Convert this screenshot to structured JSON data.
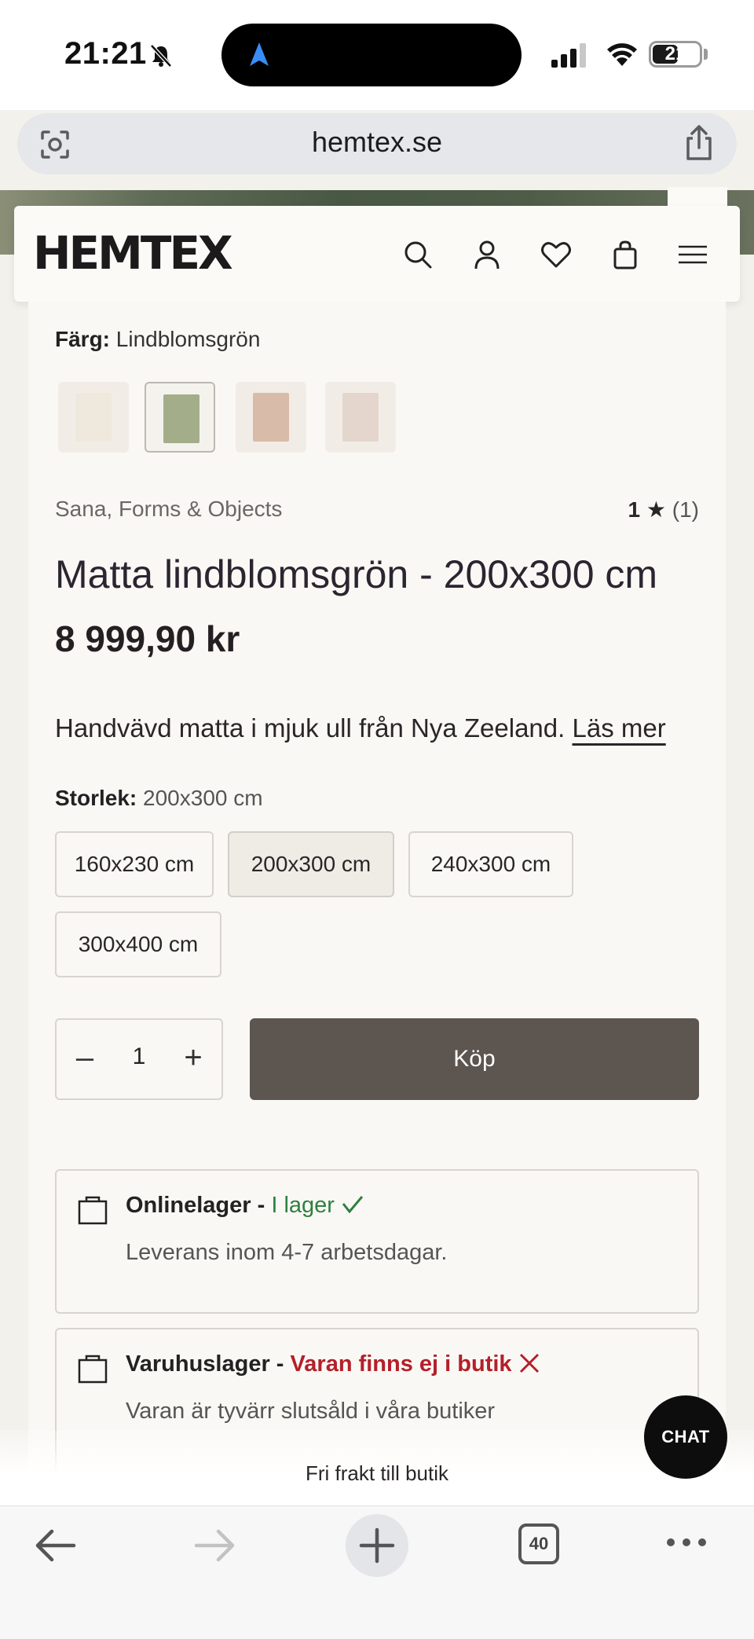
{
  "status_bar": {
    "time": "21:21",
    "battery": "21"
  },
  "browser": {
    "url": "hemtex.se",
    "tab_count": "40"
  },
  "header": {
    "logo": "HEMTEX"
  },
  "product": {
    "color_label": "Färg:",
    "color_value": "Lindblomsgrön",
    "swatches": [
      {
        "name": "white",
        "color": "#efe9dd"
      },
      {
        "name": "lindblomsgron",
        "color": "#a4ad8a"
      },
      {
        "name": "rose",
        "color": "#d8bba8"
      },
      {
        "name": "pale-pink",
        "color": "#e4d6cc"
      }
    ],
    "brand": "Sana, Forms & Objects",
    "rating_value": "1",
    "rating_star": "★",
    "rating_count": "(1)",
    "title": "Matta lindblomsgrön - 200x300 cm",
    "price": "8 999,90 kr",
    "description": "Handvävd matta i mjuk ull från Nya Zeeland.",
    "read_more": "Läs mer",
    "size_label": "Storlek:",
    "size_value": "200x300 cm",
    "sizes": [
      "160x230 cm",
      "200x300 cm",
      "240x300 cm",
      "300x400 cm"
    ],
    "selected_size": "200x300 cm",
    "quantity": "1",
    "buy_label": "Köp"
  },
  "stock": {
    "online": {
      "label": "Onlinelager -",
      "status": "I lager",
      "sub": "Leverans inom 4-7 arbetsdagar."
    },
    "store": {
      "label": "Varuhuslager -",
      "status": "Varan finns ej i butik",
      "sub": "Varan är tyvärr slutsåld i våra butiker"
    }
  },
  "free_shipping": "Fri frakt till butik",
  "chat_label": "CHAT",
  "colors": {
    "buy_button": "#5c5550",
    "in_stock": "#2e8040",
    "out_of_stock": "#b3202a"
  }
}
